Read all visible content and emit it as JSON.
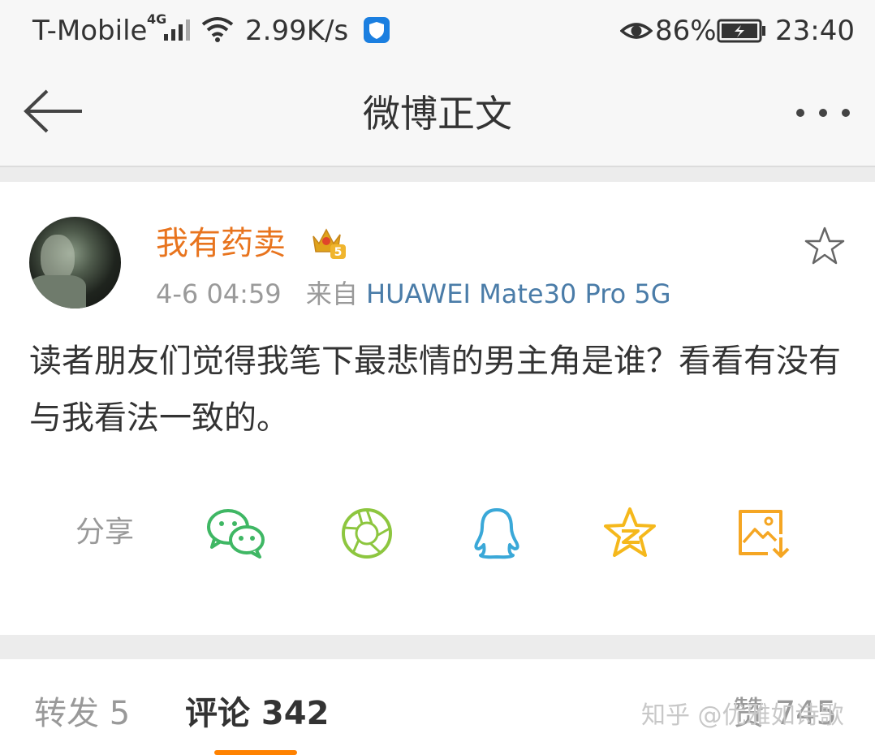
{
  "status": {
    "carrier": "T-Mobile",
    "network": "4G",
    "speed": "2.99K/s",
    "battery": "86%",
    "time": "23:40",
    "icons": [
      "signal-icon",
      "wifi-icon",
      "shield-app-icon",
      "eye-icon",
      "battery-icon"
    ]
  },
  "nav": {
    "title": "微博正文",
    "back_icon": "back-arrow-icon",
    "more_icon": "more-dots-icon"
  },
  "post": {
    "username": "我有药卖",
    "vip_level": "5",
    "time": "4-6 04:59",
    "source_prefix": "来自",
    "device": "HUAWEI Mate30 Pro 5G",
    "content": "读者朋友们觉得我笔下最悲情的男主角是谁？看看有没有与我看法一致的。"
  },
  "share": {
    "label": "分享",
    "targets": [
      "wechat-icon",
      "moments-icon",
      "qq-icon",
      "qzone-icon",
      "save-image-icon"
    ]
  },
  "tabs": {
    "repost": "转发 5",
    "comment": "评论 342",
    "like": "赞 745",
    "accent": "#ff8200"
  },
  "watermark": "知乎 @优雅如诗歌"
}
